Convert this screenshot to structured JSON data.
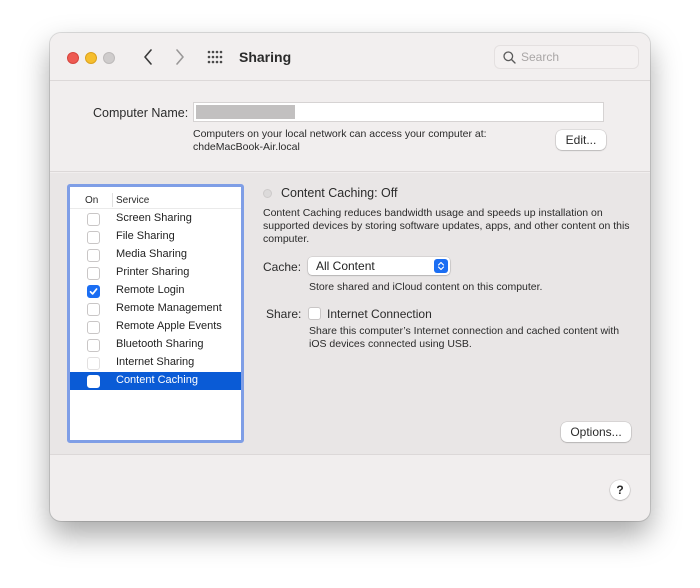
{
  "window": {
    "title": "Sharing",
    "search_placeholder": "Search"
  },
  "computer_name": {
    "label": "Computer Name:",
    "value": "",
    "info_line1": "Computers on your local network can access your computer at:",
    "info_line2": "chdeMacBook-Air.local",
    "edit_label": "Edit..."
  },
  "services": {
    "header_on": "On",
    "header_service": "Service",
    "items": [
      {
        "label": "Screen Sharing",
        "checked": false
      },
      {
        "label": "File Sharing",
        "checked": false
      },
      {
        "label": "Media Sharing",
        "checked": false
      },
      {
        "label": "Printer Sharing",
        "checked": false
      },
      {
        "label": "Remote Login",
        "checked": true
      },
      {
        "label": "Remote Management",
        "checked": false
      },
      {
        "label": "Remote Apple Events",
        "checked": false
      },
      {
        "label": "Bluetooth Sharing",
        "checked": false
      },
      {
        "label": "Internet Sharing",
        "checked": false
      },
      {
        "label": "Content Caching",
        "checked": false,
        "selected": true
      }
    ]
  },
  "detail": {
    "status": "Content Caching: Off",
    "description": "Content Caching reduces bandwidth usage and speeds up installation on supported devices by storing software updates, apps, and other content on this computer.",
    "cache_label": "Cache:",
    "cache_value": "All Content",
    "cache_note": "Store shared and iCloud content on this computer.",
    "share_label": "Share:",
    "share_option": "Internet Connection",
    "share_note": "Share this computer’s Internet connection and cached content with iOS devices connected using USB.",
    "options_label": "Options..."
  },
  "help_label": "?",
  "colors": {
    "accent": "#1b6ef3",
    "selection": "#0a5bd6",
    "focus_ring": "#7f9ee6"
  }
}
